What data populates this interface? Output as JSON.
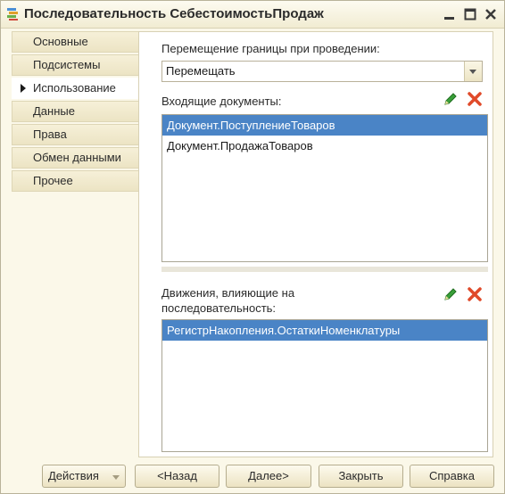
{
  "window": {
    "title": "Последовательность СебестоимостьПродаж"
  },
  "sidebar": {
    "items": [
      {
        "label": "Основные"
      },
      {
        "label": "Подсистемы"
      },
      {
        "label": "Использование",
        "active": true
      },
      {
        "label": "Данные"
      },
      {
        "label": "Права"
      },
      {
        "label": "Обмен данными"
      },
      {
        "label": "Прочее"
      }
    ]
  },
  "main": {
    "border_move_label": "Перемещение границы при проведении:",
    "border_move_value": "Перемещать",
    "incoming_label": "Входящие документы:",
    "incoming_docs": [
      "Документ.ПоступлениеТоваров",
      "Документ.ПродажаТоваров"
    ],
    "movements_label_line1": "Движения, влияющие на",
    "movements_label_line2": "последовательность:",
    "movements": [
      "РегистрНакопления.ОстаткиНоменклатуры"
    ]
  },
  "footer": {
    "actions_label": "Действия",
    "back_label": "<Назад",
    "next_label": "Далее>",
    "close_label": "Закрыть",
    "help_label": "Справка"
  },
  "colors": {
    "selection": "#4a84c6",
    "panel_bg": "#fbf8e9",
    "edit_icon": "#2e8b2e",
    "delete_icon": "#e04a2a"
  }
}
